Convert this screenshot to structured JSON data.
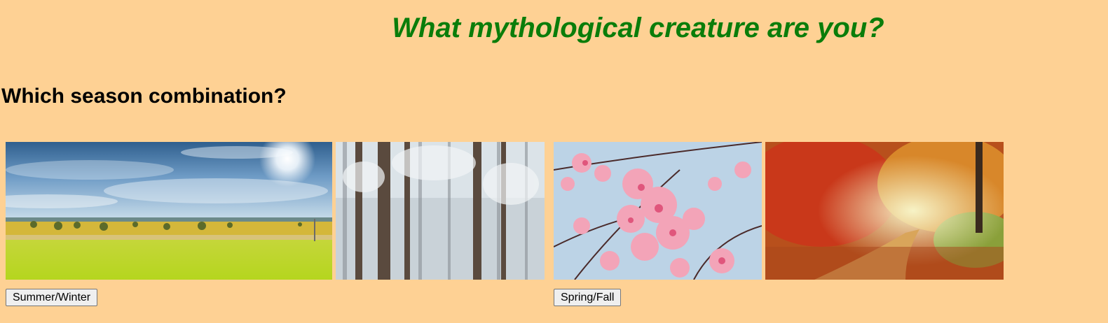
{
  "page": {
    "title": "What mythological creature are you?",
    "question": "Which season combination?"
  },
  "options": [
    {
      "button_label": "Summer/Winter",
      "images": [
        "summer field",
        "winter forest"
      ]
    },
    {
      "button_label": "Spring/Fall",
      "images": [
        "spring cherry blossoms",
        "autumn forest path"
      ]
    }
  ],
  "colors": {
    "background": "#fed194",
    "title": "#0a7d0a"
  }
}
